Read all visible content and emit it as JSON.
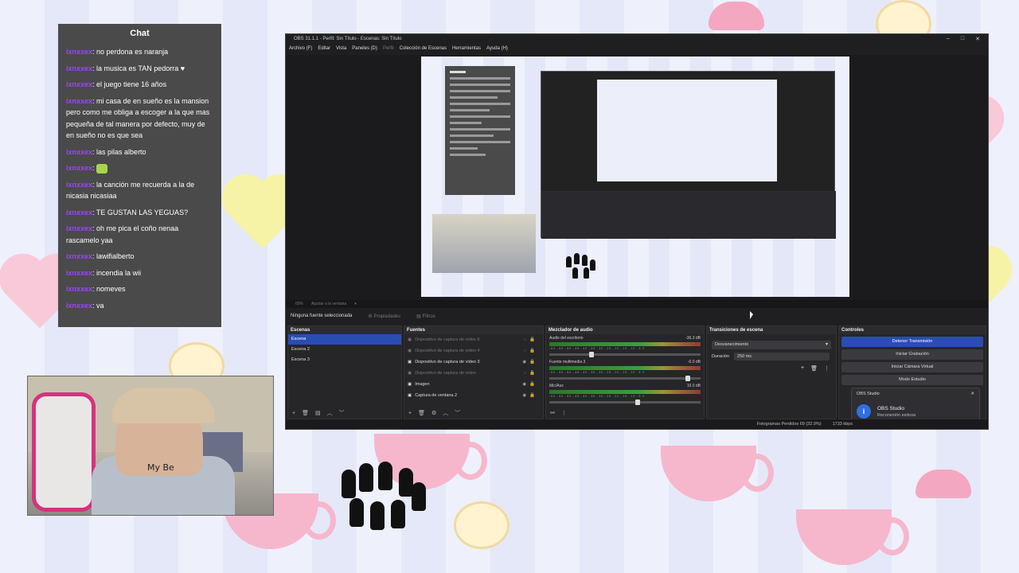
{
  "chat": {
    "title": "Chat",
    "messages": [
      {
        "user": "ixnxxex",
        "text": ": no perdona es naranja"
      },
      {
        "user": "ixnxxex",
        "text": ": la musica es TAN pedorra ♥"
      },
      {
        "user": "ixnxxex",
        "text": ": el juego tiene 16 años"
      },
      {
        "user": "ixnxxex",
        "text": ": mi casa de en sueño es la mansion pero como me obliga a escoger a la que mas pequeña de tal manera por defecto, muy de en sueño no es que sea"
      },
      {
        "user": "ixnxxex",
        "text": ": las pilas alberto"
      },
      {
        "user": "ixnxxex",
        "text": ":"
      },
      {
        "user": "ixnxxex",
        "text": ": la canción me recuerda a la de nicasia nicasiaa"
      },
      {
        "user": "ixnxxex",
        "text": ": TE GUSTAN LAS YEGUAS?"
      },
      {
        "user": "ixnxxex",
        "text": ": oh me pica el coño nenaa rascamelo yaa"
      },
      {
        "user": "ixnxxex",
        "text": ": lawifialberto"
      },
      {
        "user": "ixnxxex",
        "text": ": incendia la wii"
      },
      {
        "user": "ixnxxex",
        "text": ": nomeves"
      },
      {
        "user": "ixnxxex",
        "text": ": va"
      }
    ]
  },
  "webcam": {
    "shirt_text": "My Be"
  },
  "obs": {
    "title": "OBS 31.1.1 - Perfil: Sin Título - Escenas: Sin Título",
    "window_controls": [
      "–",
      "□",
      "✕"
    ],
    "menu": [
      "Archivo (F)",
      "Editar",
      "Vista",
      "Paneles (D)",
      "Perfil",
      "Colección de Escenas",
      "Herramientas",
      "Ayuda (H)"
    ],
    "toolbar": {
      "zoom": "60%",
      "fit": "Ajustar a la ventana"
    },
    "source_bar": {
      "no_source": "Ninguna fuente seleccionada",
      "properties": "Propiedades",
      "filters": "Filtros"
    },
    "scenes": {
      "title": "Escenas",
      "items": [
        "Escena",
        "Escena 2",
        "Escena 3"
      ]
    },
    "sources": {
      "title": "Fuentes",
      "items": [
        {
          "name": "Dispositivo de captura de vídeo 5",
          "hidden": true
        },
        {
          "name": "Dispositivo de captura de vídeo 4",
          "hidden": true
        },
        {
          "name": "Dispositivo de captura de vídeo 3",
          "hidden": false
        },
        {
          "name": "Dispositivo de captura de vídeo",
          "hidden": true
        },
        {
          "name": "Imagen",
          "hidden": false
        },
        {
          "name": "Captura de ventana 2",
          "hidden": false
        }
      ]
    },
    "mixer": {
      "title": "Mezclador de audio",
      "channels": [
        {
          "name": "Audio del escritorio",
          "db": "-36.3 dB",
          "level": 0.28
        },
        {
          "name": "Fuente multimedia 3",
          "db": "-0.0 dB",
          "level": 0.95
        },
        {
          "name": "Mic/Aux",
          "db": "10.0 dB",
          "level": 0.6
        }
      ],
      "scale": "-60 -55 -50 -45 -40 -35 -30 -25 -20 -15 -10 -5 0"
    },
    "transitions": {
      "title": "Transiciones de escena",
      "selected": "Desvanecimiento",
      "duration_label": "Duración",
      "duration_value": "250 ms"
    },
    "controls": {
      "title": "Controles",
      "buttons": [
        "Detener Transmisión",
        "Iniciar Grabación",
        "Iniciar Cámara Virtual",
        "Modo Estudio"
      ]
    },
    "notification": {
      "head": "OBS Studio",
      "title": "OBS Studio",
      "text": "Reconexión exitosa"
    },
    "status": {
      "frames_dropped": "Fotogramas Perdidos 69 (32.9%)",
      "bitrate": "1733 kbps"
    }
  },
  "colors": {
    "chat_user": "#9a46ff",
    "obs_accent": "#2a4db3",
    "chat_bg": "#4a4a4a"
  }
}
